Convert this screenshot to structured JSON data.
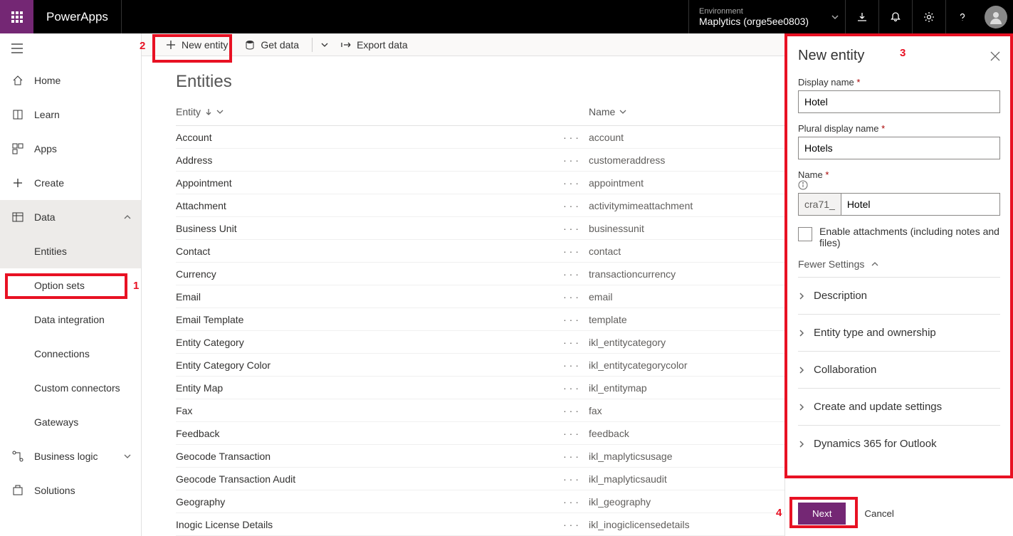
{
  "brand": "PowerApps",
  "environment": {
    "label": "Environment",
    "value": "Maplytics (orge5ee0803)"
  },
  "sidebar": {
    "items": [
      {
        "label": "Home"
      },
      {
        "label": "Learn"
      },
      {
        "label": "Apps"
      },
      {
        "label": "Create"
      },
      {
        "label": "Data"
      },
      {
        "label": "Business logic"
      },
      {
        "label": "Solutions"
      }
    ],
    "data_subs": [
      "Entities",
      "Option sets",
      "Data integration",
      "Connections",
      "Custom connectors",
      "Gateways"
    ]
  },
  "cmdbar": {
    "new_entity": "New entity",
    "get_data": "Get data",
    "export_data": "Export data"
  },
  "page_title": "Entities",
  "columns": {
    "entity": "Entity",
    "name": "Name"
  },
  "rows": [
    {
      "entity": "Account",
      "name": "account"
    },
    {
      "entity": "Address",
      "name": "customeraddress"
    },
    {
      "entity": "Appointment",
      "name": "appointment"
    },
    {
      "entity": "Attachment",
      "name": "activitymimeattachment"
    },
    {
      "entity": "Business Unit",
      "name": "businessunit"
    },
    {
      "entity": "Contact",
      "name": "contact"
    },
    {
      "entity": "Currency",
      "name": "transactioncurrency"
    },
    {
      "entity": "Email",
      "name": "email"
    },
    {
      "entity": "Email Template",
      "name": "template"
    },
    {
      "entity": "Entity Category",
      "name": "ikl_entitycategory"
    },
    {
      "entity": "Entity Category Color",
      "name": "ikl_entitycategorycolor"
    },
    {
      "entity": "Entity Map",
      "name": "ikl_entitymap"
    },
    {
      "entity": "Fax",
      "name": "fax"
    },
    {
      "entity": "Feedback",
      "name": "feedback"
    },
    {
      "entity": "Geocode Transaction",
      "name": "ikl_maplyticsusage"
    },
    {
      "entity": "Geocode Transaction Audit",
      "name": "ikl_maplyticsaudit"
    },
    {
      "entity": "Geography",
      "name": "ikl_geography"
    },
    {
      "entity": "Inogic License Details",
      "name": "ikl_inogiclicensedetails"
    }
  ],
  "panel": {
    "title": "New entity",
    "display_name_label": "Display name",
    "display_name_value": "Hotel",
    "plural_label": "Plural display name",
    "plural_value": "Hotels",
    "name_label": "Name",
    "name_prefix": "cra71_",
    "name_value": "Hotel",
    "enable_attachments": "Enable attachments (including notes and files)",
    "fewer_settings": "Fewer Settings",
    "sections": [
      "Description",
      "Entity type and ownership",
      "Collaboration",
      "Create and update settings",
      "Dynamics 365 for Outlook"
    ],
    "next": "Next",
    "cancel": "Cancel"
  },
  "annotations": {
    "n1": "1",
    "n2": "2",
    "n3": "3",
    "n4": "4"
  }
}
